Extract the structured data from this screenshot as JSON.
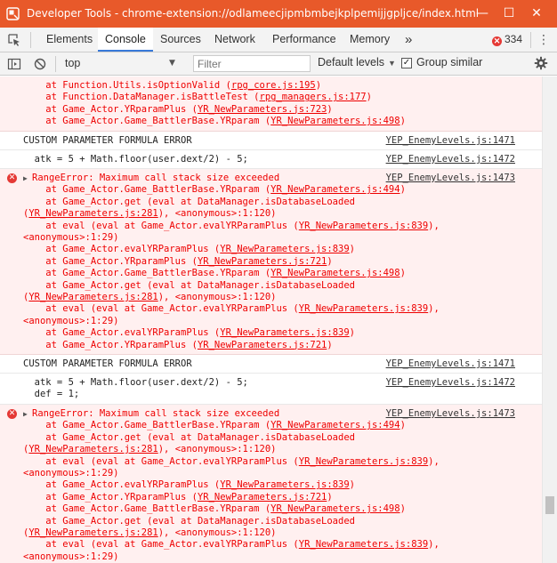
{
  "window": {
    "title": "Developer Tools - chrome-extension://odlameecjipmbmbejkplpemijjgpljce/index.html",
    "minimize_glyph": "—",
    "maximize_glyph": "☐",
    "close_glyph": "✕"
  },
  "tabs": [
    "Elements",
    "Console",
    "Sources",
    "Network",
    "Performance",
    "Memory"
  ],
  "more_tabs_glyph": "»",
  "error_count": "334",
  "toolbar": {
    "context": "top",
    "filter_placeholder": "Filter",
    "levels": "Default levels",
    "group_similar_label": "Group similar",
    "group_similar_checked": true
  },
  "colors": {
    "title_bar": "#e8592a",
    "accent": "#3879d9",
    "error_text": "#e00000",
    "error_bg": "#fff0f0"
  },
  "messages": [
    {
      "type": "error-cont",
      "lines": [
        {
          "pre": "    at Function.Utils.isOptionValid (",
          "link": "rpg_core.js:195",
          "post": ")"
        },
        {
          "pre": "    at Function.DataManager.isBattleTest (",
          "link": "rpg_managers.js:177",
          "post": ")"
        },
        {
          "pre": "    at Game_Actor.YRparamPlus (",
          "link": "YR_NewParameters.js:723",
          "post": ")"
        },
        {
          "pre": "    at Game_Actor.Game_BattlerBase.YRparam (",
          "link": "YR_NewParameters.js:498",
          "post": ")"
        }
      ]
    },
    {
      "type": "log",
      "text": "CUSTOM PARAMETER FORMULA ERROR",
      "source": "YEP_EnemyLevels.js:1471"
    },
    {
      "type": "log",
      "text": "  atk = 5 + Math.floor(user.dext/2) - 5;",
      "source": "YEP_EnemyLevels.js:1472"
    },
    {
      "type": "error",
      "head": "RangeError: Maximum call stack size exceeded",
      "source": "YEP_EnemyLevels.js:1473",
      "lines": [
        {
          "pre": "    at Game_Actor.Game_BattlerBase.YRparam (",
          "link": "YR_NewParameters.js:494",
          "post": ")"
        },
        {
          "pre": "    at Game_Actor.get (eval at DataManager.isDatabaseLoaded",
          "link": "",
          "post": ""
        },
        {
          "pre": "(",
          "link": "YR_NewParameters.js:281",
          "post": "), <anonymous>:1:120)"
        },
        {
          "pre": "    at eval (eval at Game_Actor.evalYRParamPlus (",
          "link": "YR_NewParameters.js:839",
          "post": "),"
        },
        {
          "pre": "<anonymous>:1:29)",
          "link": "",
          "post": ""
        },
        {
          "pre": "    at Game_Actor.evalYRParamPlus (",
          "link": "YR_NewParameters.js:839",
          "post": ")"
        },
        {
          "pre": "    at Game_Actor.YRparamPlus (",
          "link": "YR_NewParameters.js:721",
          "post": ")"
        },
        {
          "pre": "    at Game_Actor.Game_BattlerBase.YRparam (",
          "link": "YR_NewParameters.js:498",
          "post": ")"
        },
        {
          "pre": "    at Game_Actor.get (eval at DataManager.isDatabaseLoaded",
          "link": "",
          "post": ""
        },
        {
          "pre": "(",
          "link": "YR_NewParameters.js:281",
          "post": "), <anonymous>:1:120)"
        },
        {
          "pre": "    at eval (eval at Game_Actor.evalYRParamPlus (",
          "link": "YR_NewParameters.js:839",
          "post": "),"
        },
        {
          "pre": "<anonymous>:1:29)",
          "link": "",
          "post": ""
        },
        {
          "pre": "    at Game_Actor.evalYRParamPlus (",
          "link": "YR_NewParameters.js:839",
          "post": ")"
        },
        {
          "pre": "    at Game_Actor.YRparamPlus (",
          "link": "YR_NewParameters.js:721",
          "post": ")"
        }
      ]
    },
    {
      "type": "log",
      "text": "CUSTOM PARAMETER FORMULA ERROR",
      "source": "YEP_EnemyLevels.js:1471"
    },
    {
      "type": "log2",
      "lines": [
        "  atk = 5 + Math.floor(user.dext/2) - 5;",
        "  def = 1;"
      ],
      "source": "YEP_EnemyLevels.js:1472"
    },
    {
      "type": "error",
      "head": "RangeError: Maximum call stack size exceeded",
      "source": "YEP_EnemyLevels.js:1473",
      "lines": [
        {
          "pre": "    at Game_Actor.Game_BattlerBase.YRparam (",
          "link": "YR_NewParameters.js:494",
          "post": ")"
        },
        {
          "pre": "    at Game_Actor.get (eval at DataManager.isDatabaseLoaded",
          "link": "",
          "post": ""
        },
        {
          "pre": "(",
          "link": "YR_NewParameters.js:281",
          "post": "), <anonymous>:1:120)"
        },
        {
          "pre": "    at eval (eval at Game_Actor.evalYRParamPlus (",
          "link": "YR_NewParameters.js:839",
          "post": "),"
        },
        {
          "pre": "<anonymous>:1:29)",
          "link": "",
          "post": ""
        },
        {
          "pre": "    at Game_Actor.evalYRParamPlus (",
          "link": "YR_NewParameters.js:839",
          "post": ")"
        },
        {
          "pre": "    at Game_Actor.YRparamPlus (",
          "link": "YR_NewParameters.js:721",
          "post": ")"
        },
        {
          "pre": "    at Game_Actor.Game_BattlerBase.YRparam (",
          "link": "YR_NewParameters.js:498",
          "post": ")"
        },
        {
          "pre": "    at Game_Actor.get (eval at DataManager.isDatabaseLoaded",
          "link": "",
          "post": ""
        },
        {
          "pre": "(",
          "link": "YR_NewParameters.js:281",
          "post": "), <anonymous>:1:120)"
        },
        {
          "pre": "    at eval (eval at Game_Actor.evalYRParamPlus (",
          "link": "YR_NewParameters.js:839",
          "post": "),"
        },
        {
          "pre": "<anonymous>:1:29)",
          "link": "",
          "post": ""
        }
      ]
    }
  ]
}
